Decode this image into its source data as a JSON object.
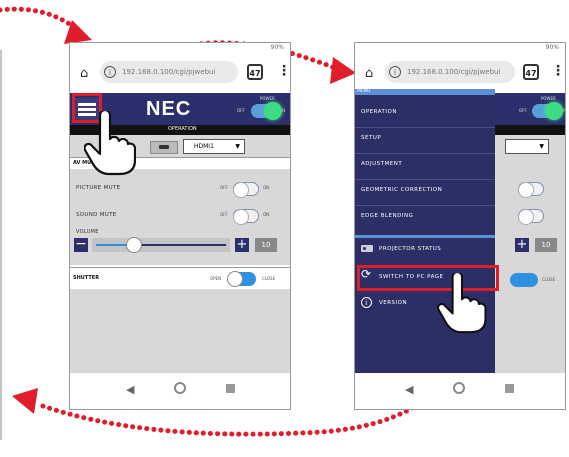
{
  "left_phone": {
    "status": "90%",
    "url": "192.168.0.100/cgi/pjwebui",
    "tab_count": "47",
    "logo": "NEC",
    "power_label": "POWER",
    "off": "OFF",
    "on": "ON",
    "section": "OPERATION",
    "input_value": "HDMI1",
    "av_mute": "AV MUTE",
    "picture_mute": "PICTURE MUTE",
    "sound_mute": "SOUND MUTE",
    "volume": "VOLUME",
    "volume_value": "10",
    "shutter": "SHUTTER",
    "shutter_open": "OPEN",
    "shutter_close": "CLOSE"
  },
  "right_phone": {
    "status": "90%",
    "url": "192.168.0.100/cgi/pjwebui",
    "tab_count": "47",
    "menu_title": "MENU",
    "menu_items": [
      "OPERATION",
      "SETUP",
      "ADJUSTMENT",
      "GEOMETRIC CORRECTION",
      "EDGE BLENDING"
    ],
    "projector_status": "PROJECTOR STATUS",
    "switch_pc": "SWITCH TO PC PAGE",
    "version": "VERSION",
    "power_label": "POWER",
    "off": "OFF",
    "on": "ON",
    "volume_value": "10",
    "shutter_close": "CLOSE"
  },
  "colors": {
    "accent_red": "#e11d2b",
    "navy": "#2b2f6b",
    "toggle_blue": "#2f8fe0",
    "power_green": "#3ddc84"
  },
  "icons": [
    "home-icon",
    "info-icon",
    "kebab-menu-icon",
    "hamburger-icon",
    "hand-pointer-icon",
    "back-nav-icon",
    "home-nav-icon",
    "recents-nav-icon",
    "projector-icon",
    "refresh-icon"
  ]
}
